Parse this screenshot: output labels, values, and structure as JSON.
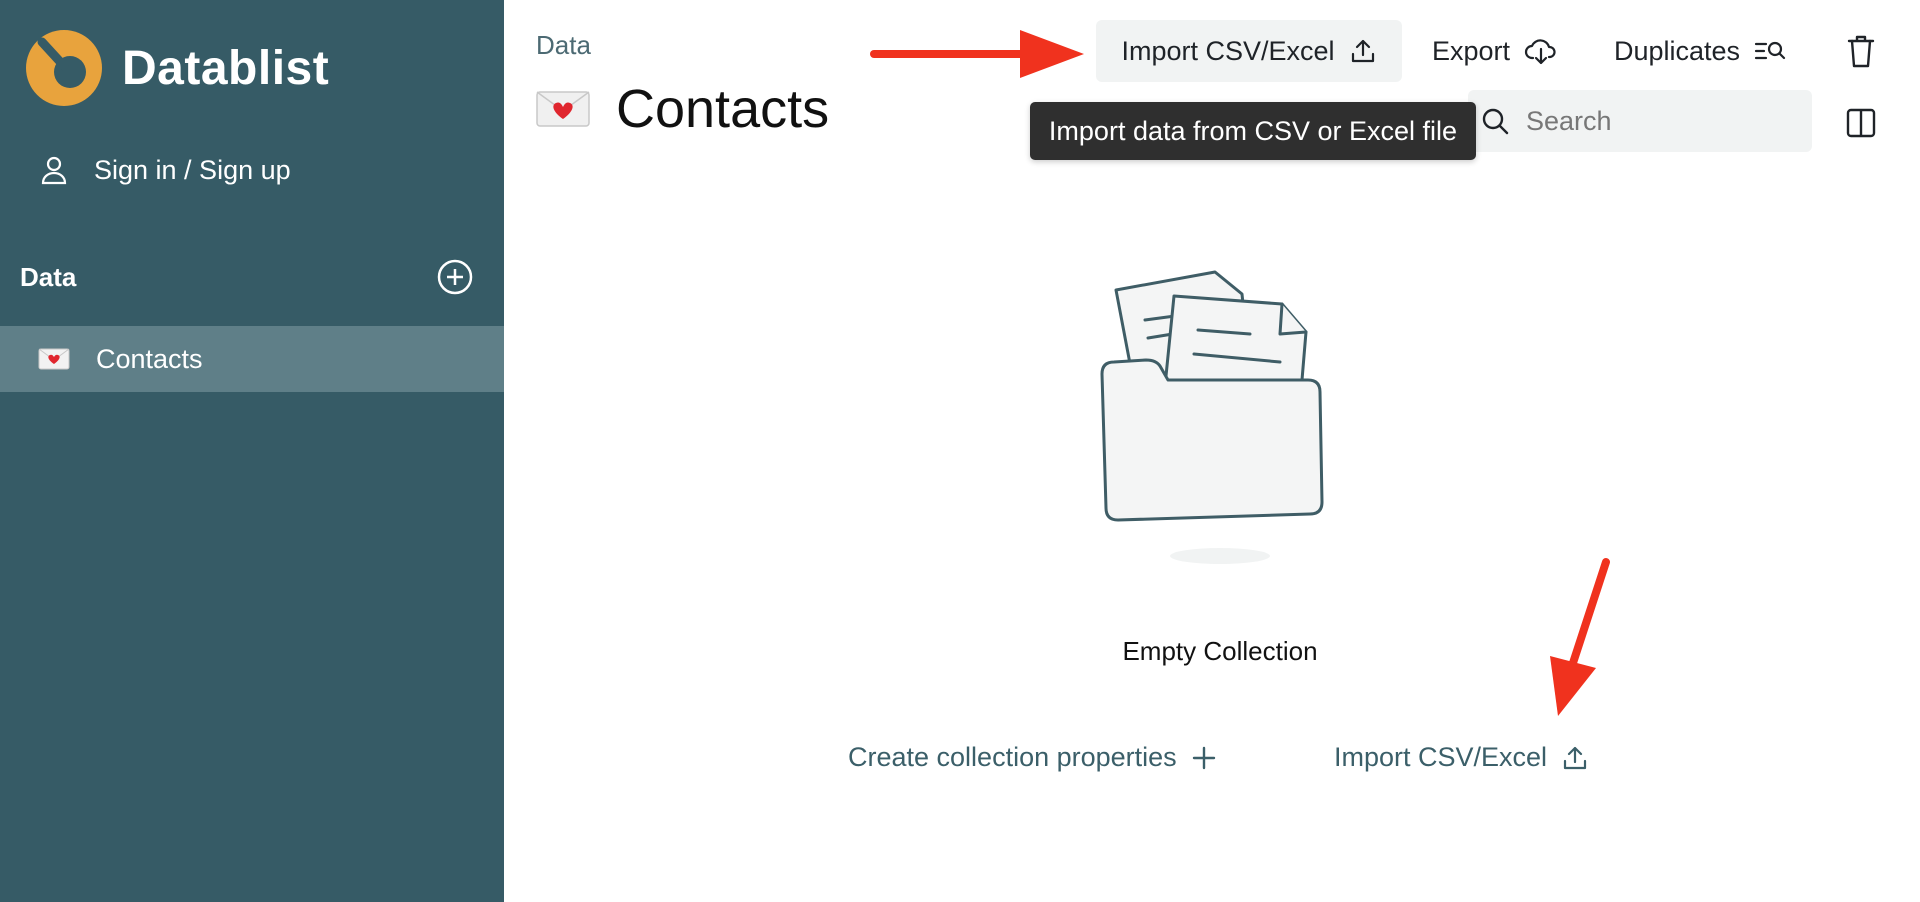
{
  "app": {
    "name": "Datablist"
  },
  "sidebar": {
    "signin_label": "Sign in / Sign up",
    "section_title": "Data",
    "collections": [
      {
        "label": "Contacts",
        "icon": "love-letter-emoji-icon"
      }
    ]
  },
  "header": {
    "breadcrumb": "Data",
    "title": "Contacts",
    "title_icon": "love-letter-emoji-icon"
  },
  "toolbar": {
    "import_label": "Import CSV/Excel",
    "export_label": "Export",
    "duplicates_label": "Duplicates",
    "delete_icon": "trash-icon",
    "split_icon": "split-view-icon"
  },
  "search": {
    "placeholder": "Search"
  },
  "tooltip": {
    "text": "Import data from CSV or Excel file"
  },
  "empty_state": {
    "title": "Empty Collection",
    "create_properties_label": "Create collection properties",
    "import_label": "Import CSV/Excel"
  },
  "colors": {
    "sidebar_bg": "#365b66",
    "sidebar_active": "#5f7f88",
    "logo_orange": "#e8a33d",
    "annotation_arrow": "#f0321e"
  }
}
